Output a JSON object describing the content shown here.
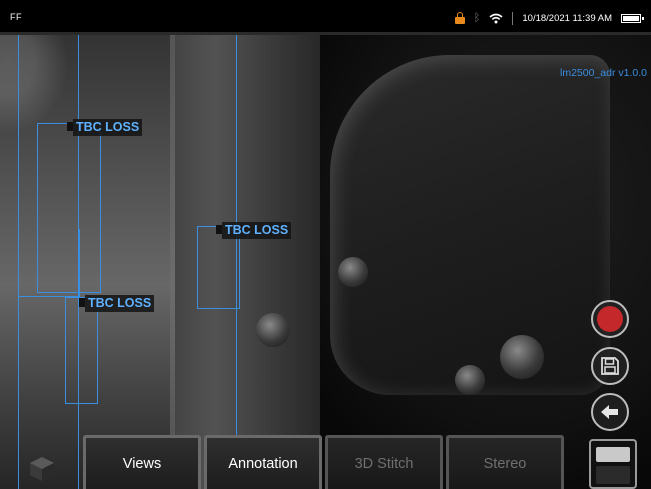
{
  "status": {
    "left_label": "FF",
    "datetime": "10/18/2021 11:39 AM",
    "icons": [
      "lock-icon",
      "bluetooth-icon",
      "wifi-icon",
      "battery-icon"
    ],
    "lock_color": "#e8891c"
  },
  "overlay": {
    "version": "lm2500_adr v1.0.0",
    "annotations": [
      {
        "label": "TBC LOSS"
      },
      {
        "label": "TBC LOSS"
      },
      {
        "label": "TBC LOSS"
      }
    ],
    "accent_color": "#3a8fe0"
  },
  "controls": {
    "record_color": "#c4282a",
    "icons": [
      "record-icon",
      "save-icon",
      "back-icon"
    ]
  },
  "tabs": [
    {
      "label": "Views",
      "enabled": true
    },
    {
      "label": "Annotation",
      "enabled": true
    },
    {
      "label": "3D Stitch",
      "enabled": false
    },
    {
      "label": "Stereo",
      "enabled": false
    }
  ]
}
